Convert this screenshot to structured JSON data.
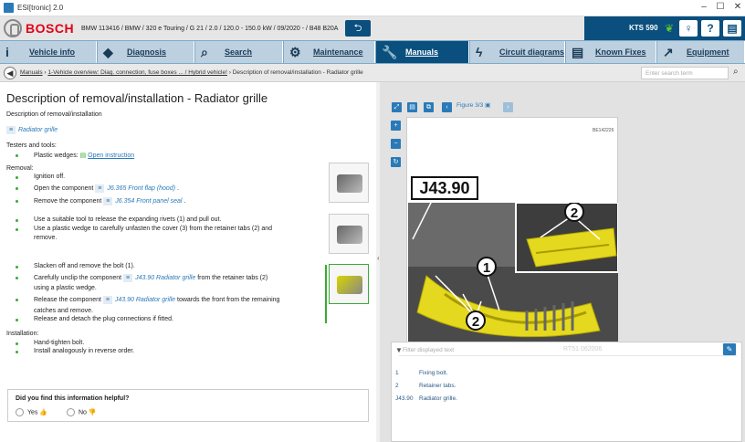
{
  "window": {
    "title": "ESI[tronic] 2.0",
    "minimize": "–",
    "maximize": "☐",
    "close": "✕"
  },
  "brand": {
    "name": "BOSCH",
    "vehicle": "BMW 113416 / BMW / 320 e Touring / G 21 / 2.0 / 120.0 - 150.0 kW / 09/2020 - / B48 B20A",
    "device": "KTS 590"
  },
  "tabs": [
    {
      "label": "Vehicle info",
      "icon": "i"
    },
    {
      "label": "Diagnosis",
      "icon": "◆"
    },
    {
      "label": "Search",
      "icon": "⌕"
    },
    {
      "label": "Maintenance",
      "icon": "⚙"
    },
    {
      "label": "Manuals",
      "icon": "🔧"
    },
    {
      "label": "Circuit diagrams",
      "icon": "ϟ"
    },
    {
      "label": "Known Fixes",
      "icon": "▤"
    },
    {
      "label": "Equipment",
      "icon": "↗"
    }
  ],
  "breadcrumb": {
    "link1": "Manuals",
    "link2": "1-Vehicle overview: Diag. connection, fuse boxes ... / Hybrid vehicle!",
    "current": "Description of removal/installation - Radiator grille",
    "sep": " › "
  },
  "search": {
    "placeholder": "Enter search term"
  },
  "doc": {
    "title": "Description of removal/installation - Radiator grille",
    "subtitle": "Description of removal/installation",
    "component": "Radiator grille",
    "testers_heading": "Testers and tools:",
    "tool_label": "Plastic wedges:",
    "tool_link": "Open instruction",
    "removal_heading": "Removal:",
    "steps": {
      "s1": "Ignition off.",
      "s2a": "Open the component",
      "s2ref": "J6.365 Front flap (hood)",
      "s2b": ".",
      "s3a": "Remove the component",
      "s3ref": "J6.354 Front panel seal",
      "s3b": ".",
      "s4": "Use a suitable tool to release the expanding rivets (1) and pull out.",
      "s5a": "Use a plastic wedge to carefully unfasten the cover (3) from the retainer tabs (2) and",
      "s5b": "remove.",
      "s6": "Slacken off and remove the bolt (1).",
      "s7a": "Carefully unclip the component",
      "s7ref": "J43.90 Radiator grille",
      "s7b": "from the retainer tabs (2)",
      "s7c": "using a plastic wedge.",
      "s8a": "Release the component",
      "s8ref": "J43.90 Radiator grille",
      "s8b": "towards the front from the remaining",
      "s8c": "catches and remove.",
      "s9": "Release and detach the plug connections if fitted."
    },
    "installation_heading": "Installation:",
    "install_steps": {
      "i1": "Hand-tighten bolt.",
      "i2": "Install analogously in reverse order."
    },
    "feedback": {
      "question": "Did you find this information helpful?",
      "yes": "Yes",
      "no": "No",
      "yes_icon": "👍",
      "no_icon": "👎"
    }
  },
  "figure": {
    "counter": "Figure 3/3",
    "code": "BE142226",
    "callout": "J43.90",
    "markers": [
      "1",
      "2",
      "2"
    ],
    "watermark": "RT51 062006",
    "filter_placeholder": "Filter displayed text",
    "legend": [
      {
        "num": "1",
        "text": "Fixing bolt."
      },
      {
        "num": "2",
        "text": "Retainer tabs."
      },
      {
        "num": "J43.90",
        "text": "Radiator grille."
      }
    ]
  }
}
